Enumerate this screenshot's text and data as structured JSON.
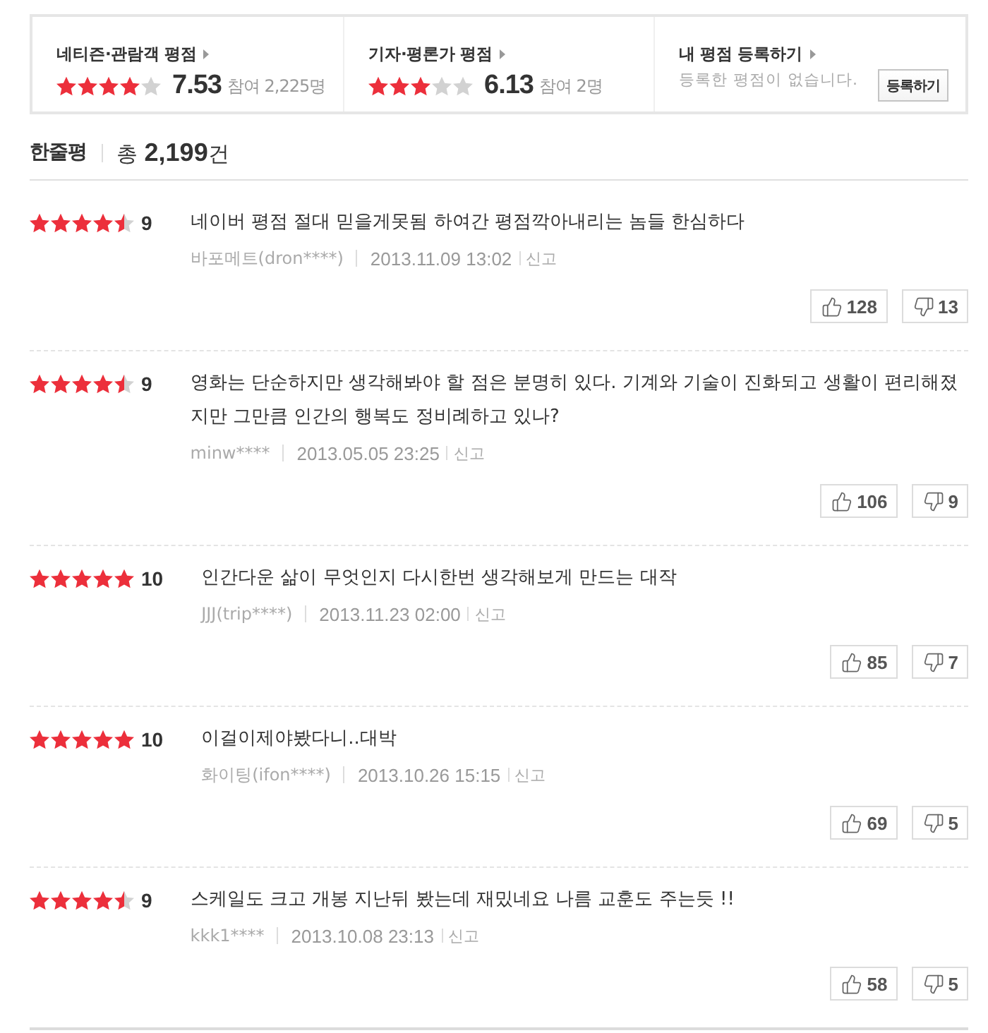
{
  "rating_summary": [
    {
      "kind": "score",
      "title": "네티즌·관람객 평점",
      "stars": 4,
      "score": "7.53",
      "participants": "참여 2,225명"
    },
    {
      "kind": "score",
      "title": "기자·평론가 평점",
      "stars": 3,
      "score": "6.13",
      "participants": "참여 2명"
    },
    {
      "kind": "register",
      "title": "내 평점 등록하기",
      "message": "등록한 평점이 없습니다.",
      "button": "등록하기"
    }
  ],
  "header": {
    "title": "한줄평",
    "total": "총 **2,199**건"
  },
  "reviews": [
    {
      "stars": 4.5,
      "score": "9",
      "text": "네이버 평점 절대 믿을게못됨 하여간 평점깍아내리는 놈들 한심하다",
      "author": "바포메트(dron****)",
      "date": "2013.11.09 13:02",
      "report": "신고",
      "likes": "128",
      "dislikes": "13"
    },
    {
      "stars": 4.5,
      "score": "9",
      "text": "영화는 단순하지만 생각해봐야 할 점은 분명히 있다. 기계와 기술이 진화되고 생활이 편리해졌지만 그만큼 인간의 행복도 정비례하고 있나?",
      "author": "minw****",
      "date": "2013.05.05 23:25",
      "report": "신고",
      "likes": "106",
      "dislikes": "9"
    },
    {
      "stars": 5,
      "score": "10",
      "text": "인간다운 삶이 무엇인지 다시한번 생각해보게 만드는 대작",
      "author": "JJJ(trip****)",
      "date": "2013.11.23 02:00",
      "report": "신고",
      "likes": "85",
      "dislikes": "7"
    },
    {
      "stars": 5,
      "score": "10",
      "text": "이걸이제야봤다니..대박",
      "author": "화이팅(ifon****)",
      "date": "2013.10.26 15:15",
      "report": "신고",
      "likes": "69",
      "dislikes": "5"
    },
    {
      "stars": 4.5,
      "score": "9",
      "text": "스케일도 크고 개봉 지난뒤 봤는데 재밌네요 나름 교훈도 주는듯 !!",
      "author": "kkk1****",
      "date": "2013.10.08 23:13",
      "report": "신고",
      "likes": "58",
      "dislikes": "5"
    }
  ]
}
